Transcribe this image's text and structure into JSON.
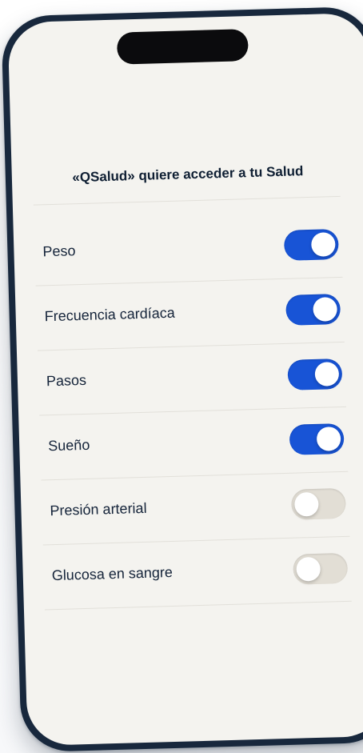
{
  "dialog": {
    "title": "«QSalud» quiere acceder a tu Salud"
  },
  "permissions": [
    {
      "label": "Peso",
      "enabled": true
    },
    {
      "label": "Frecuencia cardíaca",
      "enabled": true
    },
    {
      "label": "Pasos",
      "enabled": true
    },
    {
      "label": "Sueño",
      "enabled": true
    },
    {
      "label": "Presión arterial",
      "enabled": false
    },
    {
      "label": "Glucosa en sangre",
      "enabled": false
    }
  ],
  "colors": {
    "toggle_on": "#1854d6",
    "toggle_off": "#e2ded5",
    "screen_bg": "#f4f3ef",
    "frame": "#18283d",
    "text": "#15243a"
  }
}
